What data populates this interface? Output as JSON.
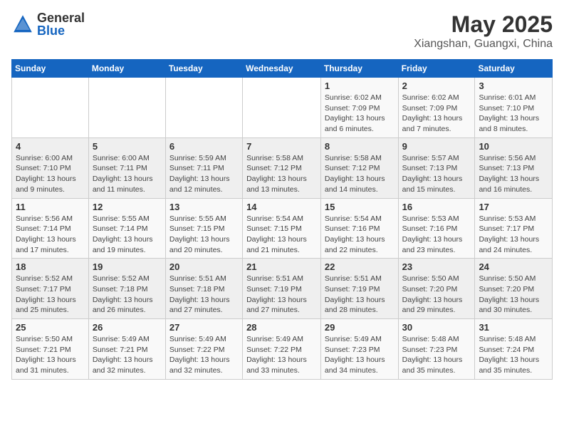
{
  "header": {
    "logo_general": "General",
    "logo_blue": "Blue",
    "month_year": "May 2025",
    "location": "Xiangshan, Guangxi, China"
  },
  "days_of_week": [
    "Sunday",
    "Monday",
    "Tuesday",
    "Wednesday",
    "Thursday",
    "Friday",
    "Saturday"
  ],
  "weeks": [
    [
      {
        "day": "",
        "info": ""
      },
      {
        "day": "",
        "info": ""
      },
      {
        "day": "",
        "info": ""
      },
      {
        "day": "",
        "info": ""
      },
      {
        "day": "1",
        "info": "Sunrise: 6:02 AM\nSunset: 7:09 PM\nDaylight: 13 hours\nand 6 minutes."
      },
      {
        "day": "2",
        "info": "Sunrise: 6:02 AM\nSunset: 7:09 PM\nDaylight: 13 hours\nand 7 minutes."
      },
      {
        "day": "3",
        "info": "Sunrise: 6:01 AM\nSunset: 7:10 PM\nDaylight: 13 hours\nand 8 minutes."
      }
    ],
    [
      {
        "day": "4",
        "info": "Sunrise: 6:00 AM\nSunset: 7:10 PM\nDaylight: 13 hours\nand 9 minutes."
      },
      {
        "day": "5",
        "info": "Sunrise: 6:00 AM\nSunset: 7:11 PM\nDaylight: 13 hours\nand 11 minutes."
      },
      {
        "day": "6",
        "info": "Sunrise: 5:59 AM\nSunset: 7:11 PM\nDaylight: 13 hours\nand 12 minutes."
      },
      {
        "day": "7",
        "info": "Sunrise: 5:58 AM\nSunset: 7:12 PM\nDaylight: 13 hours\nand 13 minutes."
      },
      {
        "day": "8",
        "info": "Sunrise: 5:58 AM\nSunset: 7:12 PM\nDaylight: 13 hours\nand 14 minutes."
      },
      {
        "day": "9",
        "info": "Sunrise: 5:57 AM\nSunset: 7:13 PM\nDaylight: 13 hours\nand 15 minutes."
      },
      {
        "day": "10",
        "info": "Sunrise: 5:56 AM\nSunset: 7:13 PM\nDaylight: 13 hours\nand 16 minutes."
      }
    ],
    [
      {
        "day": "11",
        "info": "Sunrise: 5:56 AM\nSunset: 7:14 PM\nDaylight: 13 hours\nand 17 minutes."
      },
      {
        "day": "12",
        "info": "Sunrise: 5:55 AM\nSunset: 7:14 PM\nDaylight: 13 hours\nand 19 minutes."
      },
      {
        "day": "13",
        "info": "Sunrise: 5:55 AM\nSunset: 7:15 PM\nDaylight: 13 hours\nand 20 minutes."
      },
      {
        "day": "14",
        "info": "Sunrise: 5:54 AM\nSunset: 7:15 PM\nDaylight: 13 hours\nand 21 minutes."
      },
      {
        "day": "15",
        "info": "Sunrise: 5:54 AM\nSunset: 7:16 PM\nDaylight: 13 hours\nand 22 minutes."
      },
      {
        "day": "16",
        "info": "Sunrise: 5:53 AM\nSunset: 7:16 PM\nDaylight: 13 hours\nand 23 minutes."
      },
      {
        "day": "17",
        "info": "Sunrise: 5:53 AM\nSunset: 7:17 PM\nDaylight: 13 hours\nand 24 minutes."
      }
    ],
    [
      {
        "day": "18",
        "info": "Sunrise: 5:52 AM\nSunset: 7:17 PM\nDaylight: 13 hours\nand 25 minutes."
      },
      {
        "day": "19",
        "info": "Sunrise: 5:52 AM\nSunset: 7:18 PM\nDaylight: 13 hours\nand 26 minutes."
      },
      {
        "day": "20",
        "info": "Sunrise: 5:51 AM\nSunset: 7:18 PM\nDaylight: 13 hours\nand 27 minutes."
      },
      {
        "day": "21",
        "info": "Sunrise: 5:51 AM\nSunset: 7:19 PM\nDaylight: 13 hours\nand 27 minutes."
      },
      {
        "day": "22",
        "info": "Sunrise: 5:51 AM\nSunset: 7:19 PM\nDaylight: 13 hours\nand 28 minutes."
      },
      {
        "day": "23",
        "info": "Sunrise: 5:50 AM\nSunset: 7:20 PM\nDaylight: 13 hours\nand 29 minutes."
      },
      {
        "day": "24",
        "info": "Sunrise: 5:50 AM\nSunset: 7:20 PM\nDaylight: 13 hours\nand 30 minutes."
      }
    ],
    [
      {
        "day": "25",
        "info": "Sunrise: 5:50 AM\nSunset: 7:21 PM\nDaylight: 13 hours\nand 31 minutes."
      },
      {
        "day": "26",
        "info": "Sunrise: 5:49 AM\nSunset: 7:21 PM\nDaylight: 13 hours\nand 32 minutes."
      },
      {
        "day": "27",
        "info": "Sunrise: 5:49 AM\nSunset: 7:22 PM\nDaylight: 13 hours\nand 32 minutes."
      },
      {
        "day": "28",
        "info": "Sunrise: 5:49 AM\nSunset: 7:22 PM\nDaylight: 13 hours\nand 33 minutes."
      },
      {
        "day": "29",
        "info": "Sunrise: 5:49 AM\nSunset: 7:23 PM\nDaylight: 13 hours\nand 34 minutes."
      },
      {
        "day": "30",
        "info": "Sunrise: 5:48 AM\nSunset: 7:23 PM\nDaylight: 13 hours\nand 35 minutes."
      },
      {
        "day": "31",
        "info": "Sunrise: 5:48 AM\nSunset: 7:24 PM\nDaylight: 13 hours\nand 35 minutes."
      }
    ]
  ]
}
